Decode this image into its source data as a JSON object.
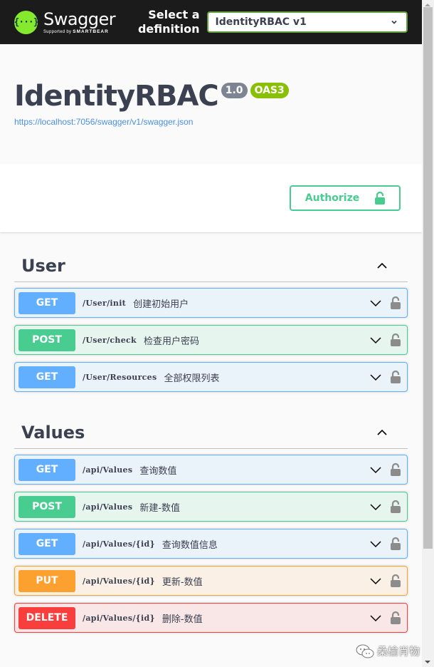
{
  "topbar": {
    "logo_name": "Swagger",
    "logo_sub_prefix": "Supported by",
    "logo_sub_brand": "SMARTBEAR",
    "logo_glyph": "{···}",
    "select_label_line1": "Select a",
    "select_label_line2": "definition",
    "selected_definition": "IdentityRBAC v1"
  },
  "info": {
    "title": "IdentityRBAC",
    "version_badge": "1.0",
    "oas_badge": "OAS3",
    "spec_url": "https://localhost:7056/swagger/v1/swagger.json"
  },
  "scheme": {
    "authorize_label": "Authorize"
  },
  "tags": [
    {
      "name": "User",
      "expanded": true,
      "operations": [
        {
          "method": "GET",
          "path": "/User/init",
          "summary": "创建初始用户"
        },
        {
          "method": "POST",
          "path": "/User/check",
          "summary": "检查用户密码"
        },
        {
          "method": "GET",
          "path": "/User/Resources",
          "summary": "全部权限列表"
        }
      ]
    },
    {
      "name": "Values",
      "expanded": true,
      "operations": [
        {
          "method": "GET",
          "path": "/api/Values",
          "summary": "查询数值"
        },
        {
          "method": "POST",
          "path": "/api/Values",
          "summary": "新建-数值"
        },
        {
          "method": "GET",
          "path": "/api/Values/{id}",
          "summary": "查询数值信息"
        },
        {
          "method": "PUT",
          "path": "/api/Values/{id}",
          "summary": "更新-数值"
        },
        {
          "method": "DELETE",
          "path": "/api/Values/{id}",
          "summary": "删除-数值"
        }
      ]
    }
  ],
  "watermark": {
    "text": "桑榆肖物",
    "icon": "wechat-icon"
  },
  "colors": {
    "topbar_bg": "#1b1b1b",
    "logo_green": "#85ea2d",
    "select_border": "#62a03f",
    "version_badge": "#7d8492",
    "oas_badge": "#89bf04",
    "link": "#4990e2",
    "authorize": "#49cc90",
    "get": "#61affe",
    "post": "#49cc90",
    "put": "#fca130",
    "delete": "#f93e3e"
  }
}
